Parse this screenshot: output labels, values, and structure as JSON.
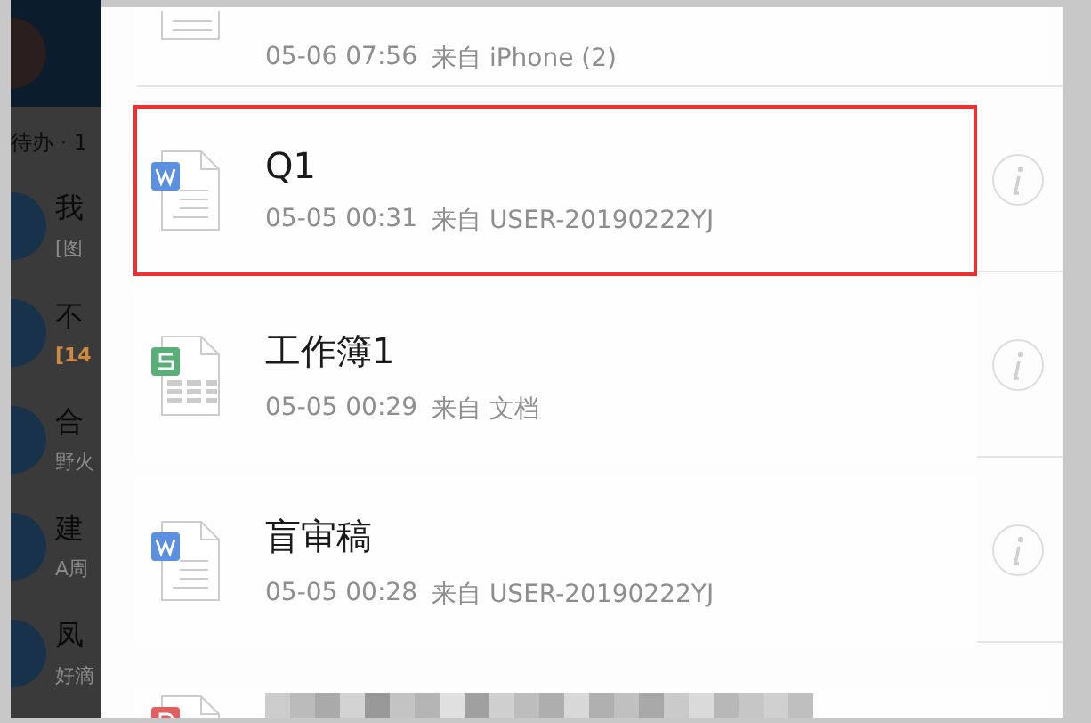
{
  "background_chat_list": {
    "section_label": "待办 · 1",
    "chats": [
      {
        "name": "我",
        "preview": "[图",
        "kind": "plain"
      },
      {
        "name": "不",
        "preview": "[14",
        "kind": "alert"
      },
      {
        "name": "合",
        "preview": "野火",
        "kind": "plain"
      },
      {
        "name": "建",
        "preview": "A周",
        "kind": "plain"
      },
      {
        "name": "凤",
        "preview": "好滴",
        "kind": "plain"
      }
    ]
  },
  "files": [
    {
      "kind": "doc",
      "time": "05-06 07:56",
      "source_label": "来自",
      "source": "iPhone (2)",
      "highlighted": false
    },
    {
      "kind": "word",
      "title": "Q1",
      "time": "05-05 00:31",
      "source_label": "来自",
      "source": "USER-20190222YJ",
      "highlighted": true
    },
    {
      "kind": "sheet",
      "title": "工作簿1",
      "time": "05-05 00:29",
      "source_label": "来自",
      "source": "文档",
      "highlighted": false
    },
    {
      "kind": "word",
      "title": "盲审稿",
      "time": "05-05 00:28",
      "source_label": "来自",
      "source": "USER-20190222YJ",
      "highlighted": false
    },
    {
      "kind": "pdf",
      "highlighted": false,
      "redacted": true
    }
  ]
}
